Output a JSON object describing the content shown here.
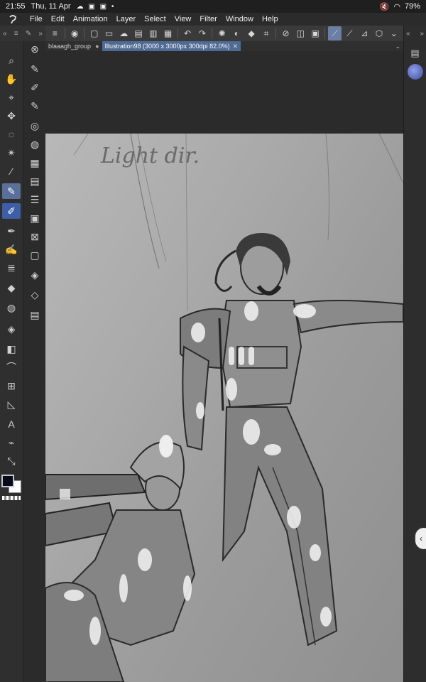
{
  "status": {
    "time": "21:55",
    "date": "Thu, 11 Apr",
    "notifications": "☁ ▣ ▣ •",
    "battery": "79%"
  },
  "menu": [
    "File",
    "Edit",
    "Animation",
    "Layer",
    "Select",
    "View",
    "Filter",
    "Window",
    "Help"
  ],
  "tabs": [
    {
      "label": "blaaagh_group",
      "active": false
    },
    {
      "label": "Illustration98 (3000 x 3000px 300dpi 82.0%)",
      "active": true
    }
  ],
  "canvas": {
    "note": "Light dir."
  },
  "colors": {
    "foreground": "#0a0a16",
    "background": "#ffffff",
    "accent": "#5a6f99"
  }
}
